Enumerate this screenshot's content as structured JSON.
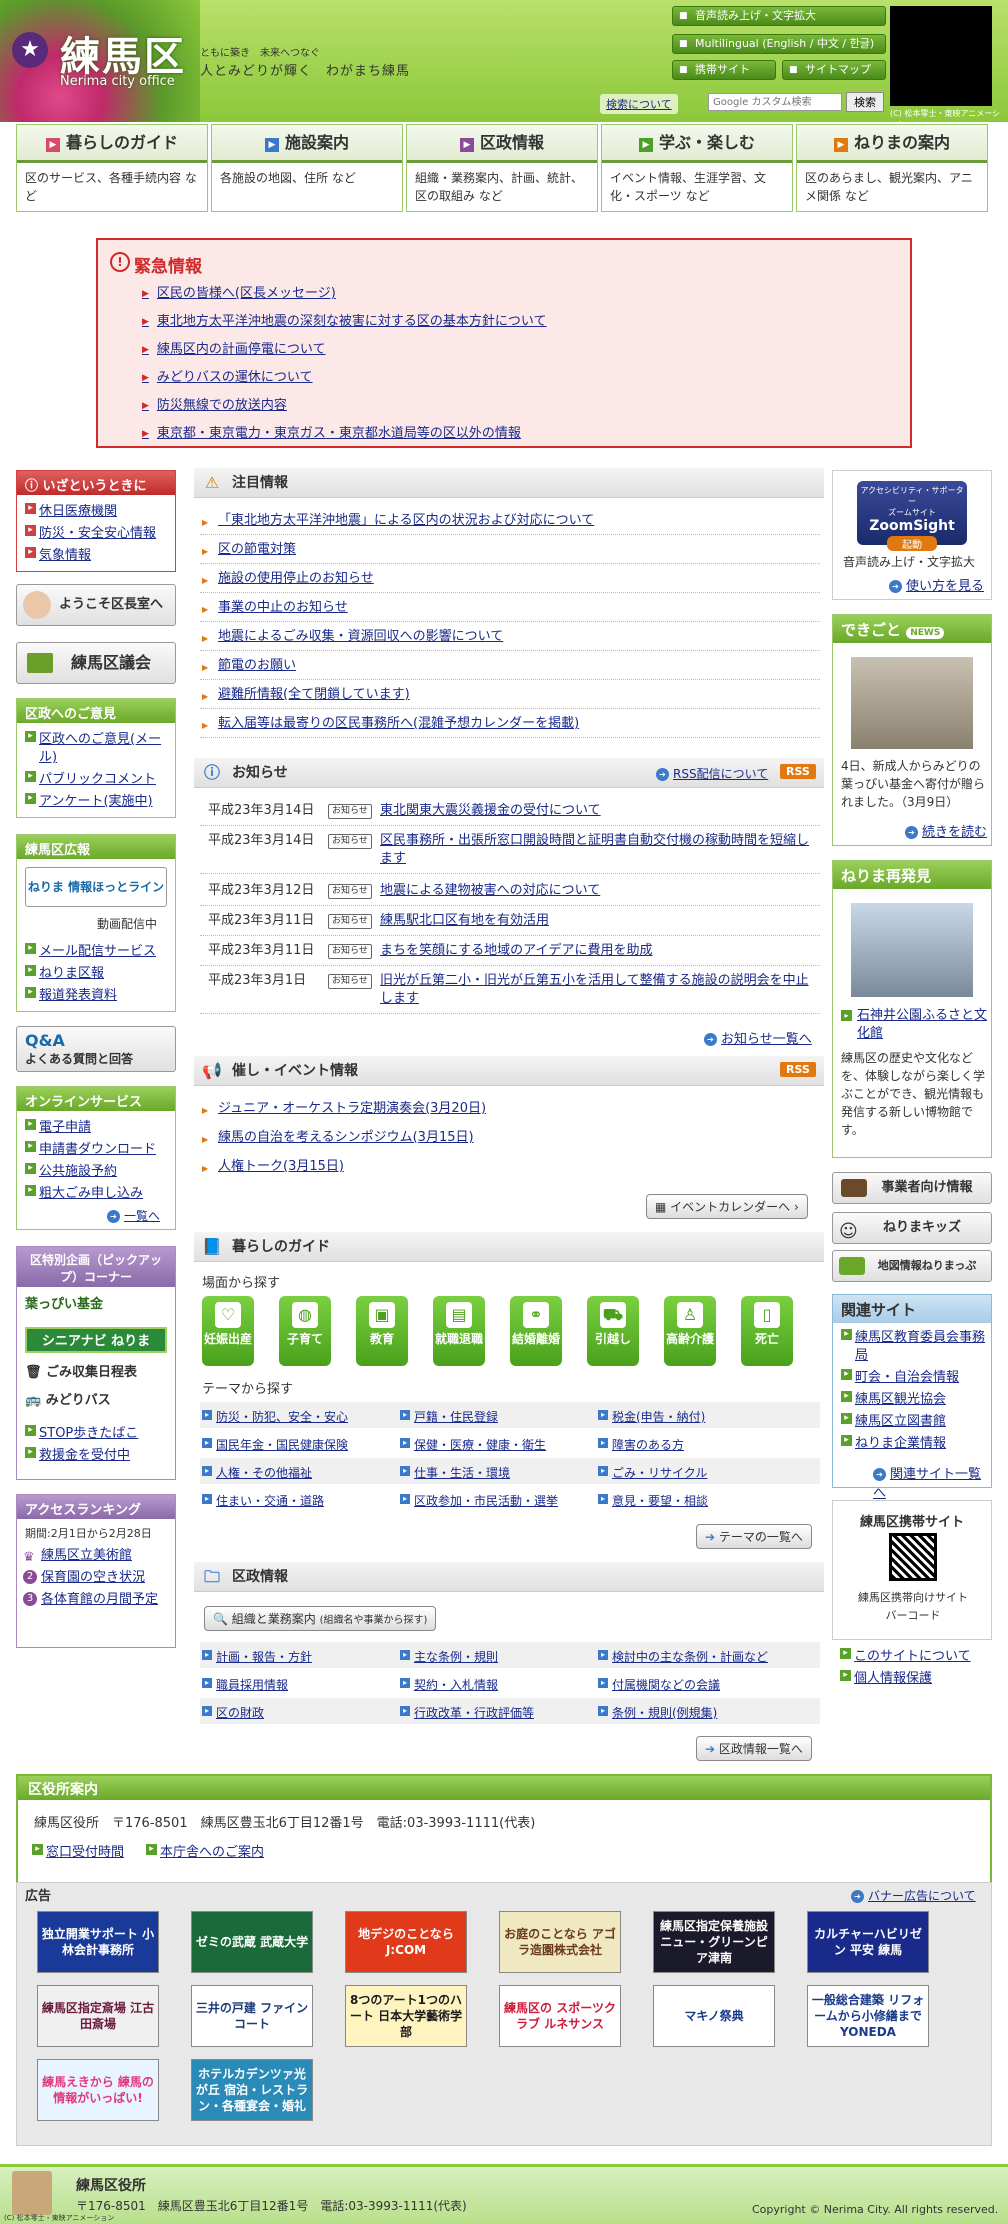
{
  "header": {
    "logo_text": "練馬区",
    "logo_sub": "Nerima city office",
    "slogan1": "ともに築き　未来へつなぐ",
    "slogan2": "人とみどりが輝く　わがまち練馬",
    "btn_voice": "音声読み上げ・文字拡大",
    "btn_lang": "Multilingual (English / 中文 / 한글)",
    "btn_mobile": "携帯サイト",
    "btn_sitemap": "サイトマップ",
    "search_label": "検索について",
    "search_placeholder": "Google カスタム検索",
    "search_button": "検索",
    "credit": "(C) 松本零士・東映アニメーション"
  },
  "nav": [
    {
      "label": "暮らしのガイド",
      "desc": "区のサービス、各種手続内容 など",
      "color": "#d84a6a"
    },
    {
      "label": "施設案内",
      "desc": "各施設の地図、住所 など",
      "color": "#3a7ac8"
    },
    {
      "label": "区政情報",
      "desc": "組織・業務案内、計画、統計、区の取組み など",
      "color": "#8a4a9a"
    },
    {
      "label": "学ぶ・楽しむ",
      "desc": "イベント情報、生涯学習、文化・スポーツ など",
      "color": "#4aa02a"
    },
    {
      "label": "ねりまの案内",
      "desc": "区のあらまし、観光案内、アニメ関係 など",
      "color": "#e07a10"
    }
  ],
  "emergency": {
    "title": "緊急情報",
    "items": [
      "区民の皆様へ(区長メッセージ)",
      "東北地方太平洋沖地震の深刻な被害に対する区の基本方針について",
      "練馬区内の計画停電について",
      "みどりバスの運休について",
      "防災無線での放送内容",
      "東京都・東京電力・東京ガス・東京都水道局等の区以外の情報"
    ]
  },
  "left": {
    "emergency_head": "いざというときに",
    "emergency_items": [
      "休日医療機関",
      "防災・安全安心情報",
      "気象情報"
    ],
    "mayor_banner": "ようこそ区長室へ",
    "council_banner": "練馬区議会",
    "opinion_head": "区政へのご意見",
    "opinion_items": [
      "区政へのご意見(メール)",
      "パブリックコメント",
      "アンケート(実施中)"
    ],
    "pr_head": "練馬区広報",
    "pr_banner": "ねりま 情報ほっとライン",
    "pr_video": "動画配信中",
    "pr_items": [
      "メール配信サービス",
      "ねりま区報",
      "報道発表資料"
    ],
    "qa_banner": "よくある質問と回答",
    "online_head": "オンラインサービス",
    "online_items": [
      "電子申請",
      "申請書ダウンロード",
      "公共施設予約",
      "粗大ごみ申し込み"
    ],
    "online_more": "一覧へ",
    "pickup_head": "区特別企画（ピックアップ）コーナー",
    "pickup_items": [
      "葉っぴい基金",
      "シニアナビ ねりま",
      "ごみ収集日程表",
      "みどりバス"
    ],
    "pickup_links": [
      "STOP歩きたばこ",
      "救援金を受付中"
    ],
    "ranking_head": "アクセスランキング",
    "ranking_period": "期間:2月1日から2月28日",
    "ranking_items": [
      "練馬区立美術館",
      "保育園の空き状況",
      "各体育館の月間予定"
    ]
  },
  "main": {
    "notice_head": "注目情報",
    "notice_items": [
      "「東北地方太平洋沖地震」による区内の状況および対応について",
      "区の節電対策",
      "施設の使用停止のお知らせ",
      "事業の中止のお知らせ",
      "地震によるごみ収集・資源回収への影響について",
      "節電のお願い",
      "避難所情報(全て閉鎖しています)",
      "転入届等は最寄りの区民事務所へ(混雑予想カレンダーを掲載)"
    ],
    "news_head": "お知らせ",
    "news_rss_about": "RSS配信について",
    "rss": "RSS",
    "news_badge": "お知らせ",
    "news_items": [
      {
        "date": "平成23年3月14日",
        "text": "東北関東大震災義援金の受付について"
      },
      {
        "date": "平成23年3月14日",
        "text": "区民事務所・出張所窓口開設時間と証明書自動交付機の稼動時間を短縮します"
      },
      {
        "date": "平成23年3月12日",
        "text": "地震による建物被害への対応について"
      },
      {
        "date": "平成23年3月11日",
        "text": "練馬駅北口区有地を有効活用"
      },
      {
        "date": "平成23年3月11日",
        "text": "まちを笑顔にする地域のアイデアに費用を助成"
      },
      {
        "date": "平成23年3月1日",
        "text": "旧光が丘第二小・旧光が丘第五小を活用して整備する施設の説明会を中止します"
      }
    ],
    "news_more": "お知らせ一覧へ",
    "event_head": "催し・イベント情報",
    "event_items": [
      "ジュニア・オーケストラ定期演奏会(3月20日)",
      "練馬の自治を考えるシンポジウム(3月15日)",
      "人権トーク(3月15日)"
    ],
    "event_calendar": "イベントカレンダーへ",
    "life_head": "暮らしのガイド",
    "life_scene": "場面から探す",
    "life_buttons": [
      "妊娠出産",
      "子育て",
      "教育",
      "就職退職",
      "結婚離婚",
      "引越し",
      "高齢介護",
      "死亡"
    ],
    "life_theme": "テーマから探す",
    "themes": [
      "防災・防犯、安全・安心",
      "戸籍・住民登録",
      "税金(申告・納付)",
      "国民年金・国民健康保険",
      "保健・医療・健康・衛生",
      "障害のある方",
      "人権・その他福祉",
      "仕事・生活・環境",
      "ごみ・リサイクル",
      "住まい・交通・道路",
      "区政参加・市民活動・選挙",
      "意見・要望・相談"
    ],
    "theme_more": "テーマの一覧へ",
    "gov_head": "区政情報",
    "gov_org_btn": "組織と業務案内",
    "gov_org_note": "(組織名や事業から探す)",
    "gov_items": [
      "計画・報告・方針",
      "主な条例・規則",
      "検討中の主な条例・計画など",
      "職員採用情報",
      "契約・入札情報",
      "付属機関などの会議",
      "区の財政",
      "行政改革・行政評価等",
      "条例・規則(例規集)"
    ],
    "gov_more": "区政情報一覧へ"
  },
  "right": {
    "zoomsight_caption1": "アクセシビリティ・サポーター",
    "zoomsight_caption2": "ズームサイト",
    "zoomsight_logo": "ZoomSight",
    "zoomsight_start": "起動",
    "zoomsight_text": "音声読み上げ・文字拡大",
    "zoomsight_link": "使い方を見る",
    "dekigoto_head": "できごと",
    "dekigoto_badge": "NEWS",
    "dekigoto_text": "4日、新成人からみどりの葉っぴい基金へ寄付が贈られました。（3月9日）",
    "dekigoto_more": "続きを読む",
    "saihakken_head": "ねりま再発見",
    "saihakken_badge": "再",
    "saihakken_badge2": "発見",
    "saihakken_link": "石神井公園ふるさと文化館",
    "saihakken_text": "練馬区の歴史や文化などを、体験しながら楽しく学ぶことができ、観光情報も発信する新しい博物館です。",
    "btn_business": "事業者向け情報",
    "btn_kids": "ねりまキッズ",
    "btn_map": "地図情報ねりまっぷ",
    "related_head": "関連サイト",
    "related_items": [
      "練馬区教育委員会事務局",
      "町会・自治会情報",
      "練馬区観光協会",
      "練馬区立図書館",
      "ねりま企業情報"
    ],
    "related_more": "関連サイト一覧へ",
    "mobile_head": "練馬区携帯サイト",
    "mobile_caption": "練馬区携帯向けサイトバーコード",
    "bottom_links": [
      "このサイトについて",
      "個人情報保護"
    ]
  },
  "office": {
    "head": "区役所案内",
    "address": "練馬区役所　〒176-8501　練馬区豊玉北6丁目12番1号　電話:03-3993-1111(代表)",
    "links": [
      "窓口受付時間",
      "本庁舎へのご案内"
    ]
  },
  "ads": {
    "head": "広告",
    "about": "バナー広告について",
    "items": [
      {
        "text": "独立開業サポート 小林会計事務所",
        "bg": "#1a3a9a",
        "fg": "#ffffff"
      },
      {
        "text": "ゼミの武蔵 武蔵大学",
        "bg": "#1a6a3a",
        "fg": "#ffffff"
      },
      {
        "text": "地デジのことなら J:COM",
        "bg": "#e03a1a",
        "fg": "#ffffff"
      },
      {
        "text": "お庭のことなら アゴラ造園株式会社",
        "bg": "#f0e8c0",
        "fg": "#6a3a1a"
      },
      {
        "text": "練馬区指定保養施設 ニュー・グリーンピア津南",
        "bg": "#1a1a2a",
        "fg": "#ffffff"
      },
      {
        "text": "カルチャーハビリゼン 平安 練馬",
        "bg": "#1a2a8a",
        "fg": "#ffffff"
      },
      {
        "text": "練馬区指定斎場 江古田斎場",
        "bg": "#f0f0f0",
        "fg": "#6a1a3a"
      },
      {
        "text": "三井の戸建 ファインコート",
        "bg": "#ffffff",
        "fg": "#1a3a7a"
      },
      {
        "text": "8つのアート1つのハート 日本大学藝術学部",
        "bg": "#fff4c0",
        "fg": "#1a1a1a"
      },
      {
        "text": "練馬区の スポーツクラブ ルネサンス",
        "bg": "#ffffff",
        "fg": "#d01a3a"
      },
      {
        "text": "マキノ祭典",
        "bg": "#ffffff",
        "fg": "#1a3a8a"
      },
      {
        "text": "一般総合建築 リフォームから小修繕まで YONEDA",
        "bg": "#ffffff",
        "fg": "#1a3a8a"
      },
      {
        "text": "練馬えきから 練馬の情報がいっぱい!",
        "bg": "#e8f4ff",
        "fg": "#e03a7a"
      },
      {
        "text": "ホテルカデンツァ光が丘 宿泊・レストラン・各種宴会・婚礼",
        "bg": "#2a8ab8",
        "fg": "#ffffff"
      }
    ]
  },
  "footer": {
    "name": "練馬区役所",
    "address": "〒176-8501　練馬区豊玉北6丁目12番1号　電話:03-3993-1111(代表)",
    "copyright": "Copyright © Nerima City. All rights reserved.",
    "credit": "(C) 松本零士・東映アニメーション"
  },
  "colors": {
    "accent_green": "#8cc83a",
    "emergency_red": "#d02a2a",
    "link_blue": "#1a2a8a"
  }
}
